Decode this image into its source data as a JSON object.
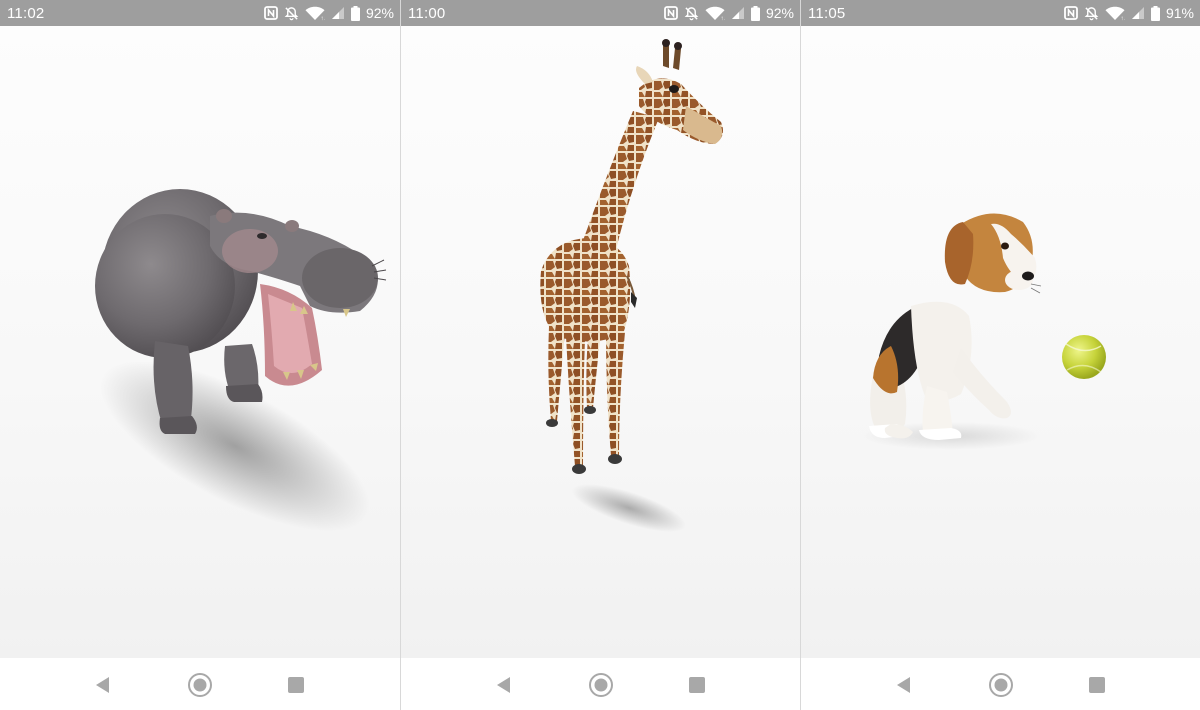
{
  "screens": [
    {
      "model": "hippopotamus",
      "status": {
        "time": "11:02",
        "battery": "92%"
      }
    },
    {
      "model": "giraffe",
      "status": {
        "time": "11:00",
        "battery": "92%"
      }
    },
    {
      "model": "beagle-with-tennis-ball",
      "status": {
        "time": "11:05",
        "battery": "91%"
      }
    }
  ],
  "status_icons": [
    "nfc-icon",
    "notifications-off-icon",
    "wifi-icon",
    "signal-icon",
    "battery-icon"
  ],
  "navigation": [
    "back-icon",
    "home-icon",
    "recents-icon"
  ],
  "colors": {
    "status_bar": "#9e9e9e",
    "nav_icons": "#a8a8a8",
    "background": "#f7f7f7"
  }
}
